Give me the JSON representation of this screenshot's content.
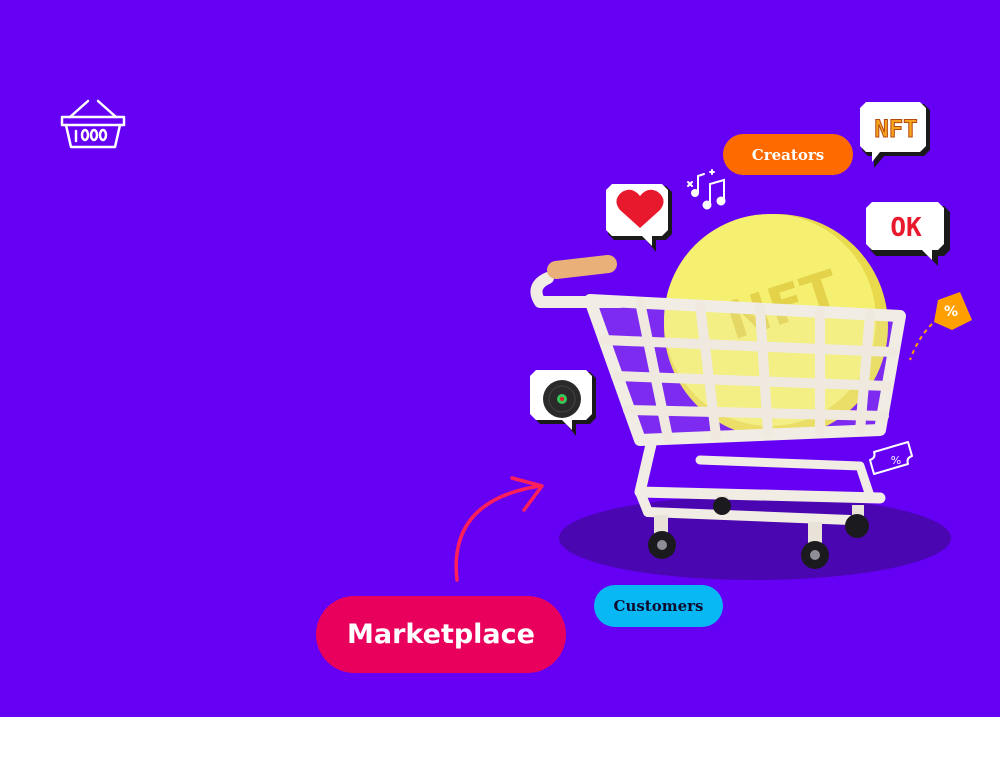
{
  "labels": {
    "creators": "Creators",
    "customers": "Customers",
    "marketplace": "Marketplace"
  },
  "bubbles": {
    "nft": "NFT",
    "ok": "OK",
    "coin": "NFT",
    "tag": "%",
    "ticket": "%"
  },
  "icons": [
    "basket-icon",
    "heart-icon",
    "music-notes-icon",
    "vinyl-record-icon",
    "shopping-cart-icon",
    "price-tag-icon",
    "ticket-icon",
    "arrow-icon"
  ],
  "colors": {
    "background": "#6500f5",
    "creators": "#ff6a00",
    "customers": "#08b8f5",
    "marketplace": "#e8005c",
    "coin": "#f4ef6a",
    "cart": "#f1ede4"
  }
}
